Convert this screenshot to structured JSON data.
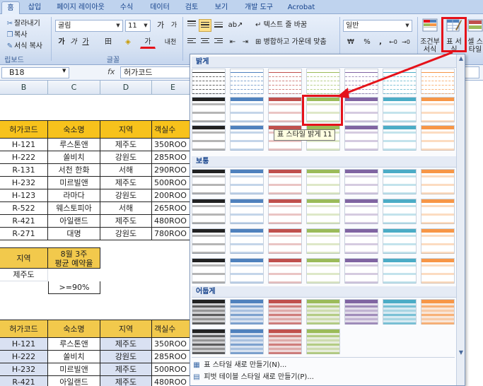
{
  "tabs": [
    {
      "label": "홈",
      "active": true
    },
    {
      "label": "삽입"
    },
    {
      "label": "페이지 레이아웃"
    },
    {
      "label": "수식"
    },
    {
      "label": "데이터"
    },
    {
      "label": "검토"
    },
    {
      "label": "보기"
    },
    {
      "label": "개발 도구"
    },
    {
      "label": "Acrobat"
    }
  ],
  "clipboard": {
    "cut": "잘라내기",
    "copy": "복사",
    "format_painter": "서식 복사",
    "group_label": "립보드"
  },
  "font": {
    "name": "굴림",
    "size": "11",
    "group_label": "글꼴",
    "grow": "가",
    "shrink": "가",
    "bold": "가",
    "italic": "가",
    "underline": "가",
    "border": "田",
    "fill": "◈",
    "color": "가",
    "phonetic": "내천"
  },
  "alignment": {
    "wrap_text": "텍스트 줄 바꿈",
    "merge_center": "병합하고 가운데 맞춤"
  },
  "number": {
    "format": "일반",
    "currency": "₩",
    "percent": "%",
    "comma": ","
  },
  "styles": {
    "conditional": "조건부 서식",
    "format_table": "표 서식",
    "cell_style": "셀 스타일"
  },
  "colors": {
    "highlight": "#e5121a",
    "header_fill": "#f7c21c",
    "blue_fill": "#d9e1f2"
  },
  "formula_bar": {
    "name_box": "B18",
    "fx": "fx",
    "value": "허가코드"
  },
  "columns": [
    "B",
    "C",
    "D",
    "E"
  ],
  "table1": {
    "headers": [
      "허가코드",
      "숙소명",
      "지역",
      "객실수"
    ],
    "rows": [
      [
        "H-121",
        "루스톤앤",
        "제주도",
        "350ROO"
      ],
      [
        "H-222",
        "쏠비치",
        "강원도",
        "285ROO"
      ],
      [
        "R-131",
        "서천 한화",
        "서해",
        "290ROO"
      ],
      [
        "H-232",
        "미르빌앤",
        "제주도",
        "500ROO"
      ],
      [
        "H-123",
        "라마다",
        "강원도",
        "200ROO"
      ],
      [
        "R-522",
        "웨스토피아",
        "서해",
        "265ROO"
      ],
      [
        "R-421",
        "아일랜드",
        "제주도",
        "480ROO"
      ],
      [
        "R-271",
        "대명",
        "강원도",
        "780ROO"
      ]
    ]
  },
  "criteria": {
    "header_region": "지역",
    "header_rate": "8월 3주 평균 예약율",
    "header_rate_line1": "8월 3주",
    "header_rate_line2": "평균 예약율",
    "region_value": "제주도",
    "rate_value": ">=90%"
  },
  "table2": {
    "headers": [
      "허가코드",
      "숙소명",
      "지역",
      "객실수"
    ],
    "rows": [
      [
        "H-121",
        "루스톤앤",
        "제주도",
        "350ROO"
      ],
      [
        "H-222",
        "쏠비치",
        "강원도",
        "285ROO"
      ],
      [
        "H-232",
        "미르빌앤",
        "제주도",
        "500ROO"
      ],
      [
        "R-421",
        "아일랜드",
        "제주도",
        "480ROO"
      ]
    ]
  },
  "gallery": {
    "section_light": "밝게",
    "section_medium": "보통",
    "section_dark": "어둡게",
    "tooltip": "표 스타일 밝게 11",
    "new_table_style": "표 스타일 새로 만들기(N)...",
    "new_pivot_style": "피벗 테이블 스타일 새로 만들기(P)...",
    "palette": [
      "#222222",
      "#4f81bd",
      "#c0504d",
      "#9bbb59",
      "#8064a2",
      "#4bacc6",
      "#f79646"
    ]
  }
}
